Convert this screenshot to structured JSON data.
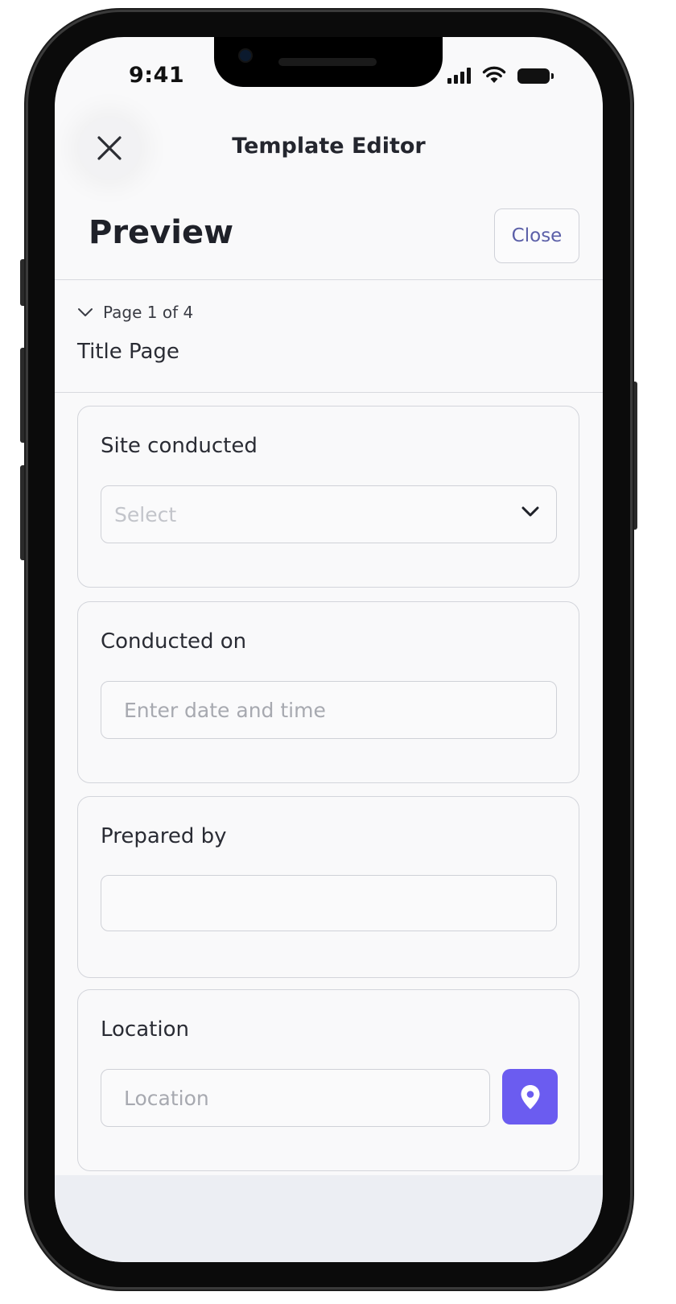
{
  "status_bar": {
    "time": "9:41"
  },
  "header": {
    "title": "Template Editor",
    "close_icon": "close-icon"
  },
  "preview": {
    "title": "Preview",
    "close_label": "Close"
  },
  "page": {
    "indicator": "Page 1 of 4",
    "name": "Title Page"
  },
  "fields": {
    "site": {
      "label": "Site conducted",
      "placeholder": "Select"
    },
    "conducted_on": {
      "label": "Conducted on",
      "placeholder": "Enter date and time"
    },
    "prepared_by": {
      "label": "Prepared by",
      "value": ""
    },
    "location": {
      "label": "Location",
      "placeholder": "Location"
    }
  },
  "colors": {
    "accent": "#6b5cf0",
    "link": "#5b5fa8"
  }
}
